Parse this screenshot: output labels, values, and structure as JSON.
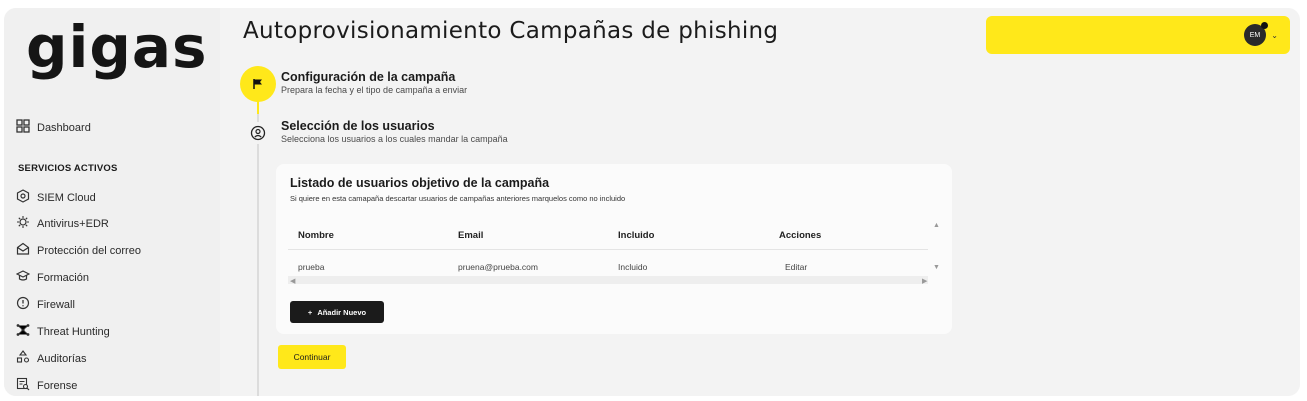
{
  "brand": {
    "logo_text": "gigas",
    "accent": "#ffe81a"
  },
  "page": {
    "title": "Autoprovisionamiento Campañas de phishing"
  },
  "user": {
    "initials": "EM"
  },
  "sidebar": {
    "dashboard": "Dashboard",
    "section_title": "SERVICIOS ACTIVOS",
    "items": [
      {
        "label": "SIEM Cloud",
        "icon": "eye-icon"
      },
      {
        "label": "Antivirus+EDR",
        "icon": "bug-icon"
      },
      {
        "label": "Protección del correo",
        "icon": "mail-shield-icon"
      },
      {
        "label": "Formación",
        "icon": "graduation-cap-icon"
      },
      {
        "label": "Firewall",
        "icon": "shield-alert-icon"
      },
      {
        "label": "Threat Hunting",
        "icon": "network-icon"
      },
      {
        "label": "Auditorías",
        "icon": "audit-icon"
      },
      {
        "label": "Forense",
        "icon": "forensic-icon"
      }
    ]
  },
  "steps": [
    {
      "title": "Configuración de la campaña",
      "subtitle": "Prepara la fecha y el tipo de campaña a enviar",
      "icon": "flag-icon"
    },
    {
      "title": "Selección de los usuarios",
      "subtitle": "Selecciona los usuarios a los cuales mandar la campaña",
      "icon": "user-circle-icon"
    }
  ],
  "card": {
    "title": "Listado de usuarios objetivo de la campaña",
    "subtitle": "Si quiere en esta camapaña descartar usuarios de campañas anteriores marquelos como no incluido",
    "columns": [
      "Nombre",
      "Email",
      "Incluido",
      "Acciones"
    ],
    "rows": [
      {
        "nombre": "prueba",
        "email": "pruena@prueba.com",
        "incluido": "Incluido",
        "accion": "Editar"
      }
    ],
    "add_button": "Añadir Nuevo"
  },
  "continue_button": "Continuar"
}
